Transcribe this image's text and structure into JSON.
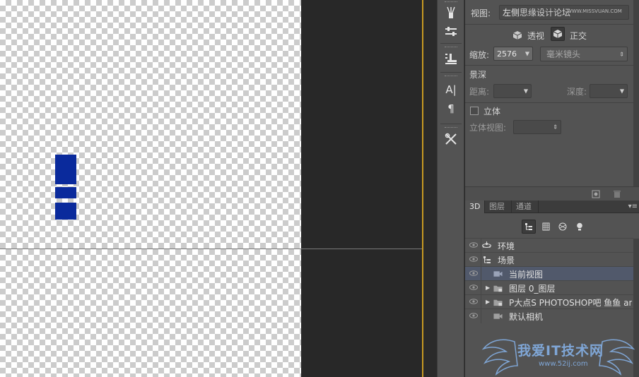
{
  "app": {
    "accent": "#c89a22",
    "selection_color": "#51596b",
    "object_color": "#0a2a9c"
  },
  "properties": {
    "view_label": "视图:",
    "view_value": "左侧",
    "view_overlay": "思缘设计论坛",
    "perspective_label": "透视",
    "ortho_label": "正交",
    "zoom_label": "缩放:",
    "zoom_value": "2576",
    "lens_value": "毫米镜头",
    "dof_heading": "景深",
    "distance_label": "距离:",
    "depth_label": "深度:",
    "stereo_label": "立体",
    "stereo_view_label": "立体视图:",
    "corner_watermark": "WWW.MISSVUAN.COM"
  },
  "tabs": [
    {
      "label": "3D",
      "active": true
    },
    {
      "label": "图层",
      "active": false
    },
    {
      "label": "通道",
      "active": false
    }
  ],
  "tools": [
    "brush-icon",
    "adjust-icon",
    "stamp-icon",
    "character-icon",
    "paragraph-icon",
    "tools-icon"
  ],
  "tool_glyphs": {
    "character": "A|",
    "paragraph": "¶"
  },
  "scene": {
    "rows": [
      {
        "label": "环境",
        "icon": "environment-icon",
        "selected": false
      },
      {
        "label": "场景",
        "icon": "scene-icon",
        "selected": false
      },
      {
        "label": "当前视图",
        "icon": "camera-icon",
        "selected": true
      },
      {
        "label": "图层 0_图层",
        "icon": "folder-icon",
        "selected": false
      },
      {
        "label": "P大点S PHOTOSHOP吧 鱼鱼 an...",
        "icon": "folder-icon",
        "selected": false
      },
      {
        "label": "默认相机",
        "icon": "camera-icon",
        "selected": false
      }
    ]
  },
  "watermark": {
    "text": "我爱IT技术网",
    "url": "www.52ij.com"
  }
}
